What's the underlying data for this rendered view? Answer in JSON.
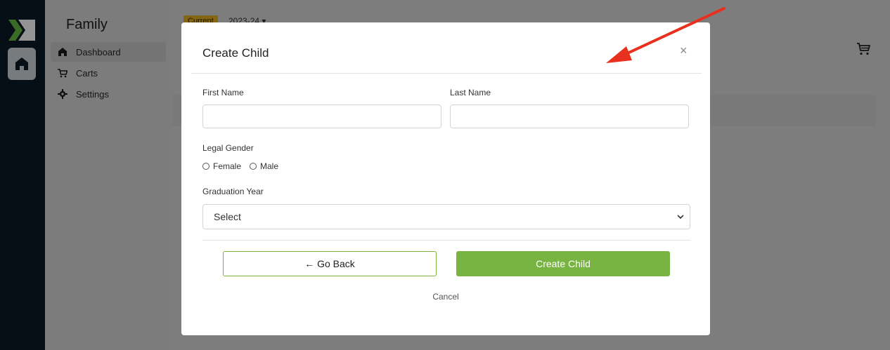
{
  "sidebar": {
    "title": "Family",
    "items": [
      {
        "label": "Dashboard",
        "icon": "home-icon",
        "active": true
      },
      {
        "label": "Carts",
        "icon": "cart-icon"
      },
      {
        "label": "Settings",
        "icon": "gear-icon"
      }
    ]
  },
  "header": {
    "season_badge": "Current",
    "season_value": "2023-24 ▾"
  },
  "modal": {
    "title": "Create Child",
    "close_label": "×",
    "first_name_label": "First Name",
    "first_name_value": "",
    "last_name_label": "Last Name",
    "last_name_value": "",
    "gender_label": "Legal Gender",
    "gender_options": [
      "Female",
      "Male"
    ],
    "graduation_label": "Graduation Year",
    "graduation_value": "Select",
    "back_label": "← Go Back",
    "create_label": "Create Child",
    "cancel_label": "Cancel"
  },
  "colors": {
    "accent_green": "#78b442",
    "annotation_arrow": "#e8301f",
    "rail_background": "#0c1a26"
  }
}
